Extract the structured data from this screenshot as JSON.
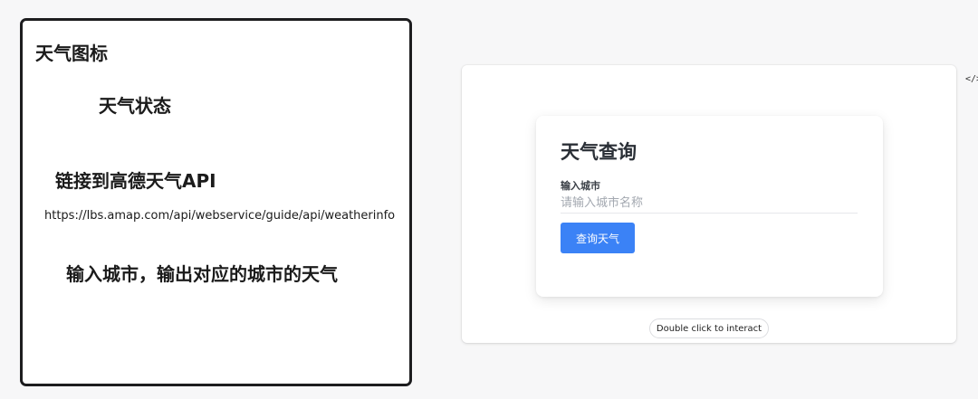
{
  "sketch": {
    "title": "天气图标",
    "status": "天气状态",
    "link_heading": "链接到高德天气API",
    "url": "https://lbs.amap.com/api/webservice/guide/api/weatherinfo",
    "description": "输入城市，输出对应的城市的天气"
  },
  "preview": {
    "card": {
      "title": "天气查询",
      "city_label": "输入城市",
      "city_placeholder": "请输入城市名称",
      "city_value": "",
      "query_button": "查询天气"
    },
    "interact_hint": "Double click to interact"
  },
  "toolbar": {
    "code_icon_glyph": "</>"
  },
  "colors": {
    "accent": "#3b82f6",
    "sketch_border": "#1d1d1f",
    "background": "#f7f7f8"
  }
}
